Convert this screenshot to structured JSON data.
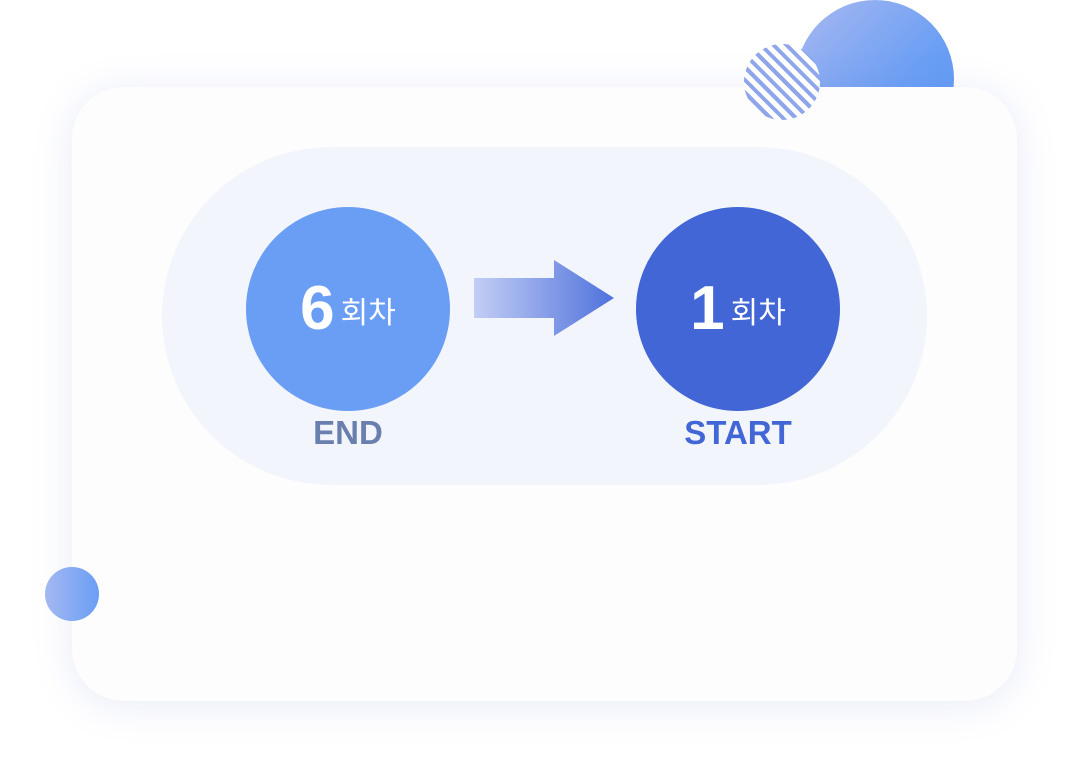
{
  "colors": {
    "end_circle": "#6a9ef4",
    "start_circle": "#4266d5",
    "end_label": "#6a7fae",
    "start_label": "#4266d5",
    "pill_background": "#f2f5fc",
    "card_background": "#fdfdfe"
  },
  "flow": {
    "from": {
      "number": "6",
      "unit": "회차",
      "label": "END"
    },
    "to": {
      "number": "1",
      "unit": "회차",
      "label": "START"
    },
    "arrow_icon": "arrow-right-icon"
  },
  "decorations": [
    "half-circle",
    "striped-circle",
    "small-circle"
  ]
}
